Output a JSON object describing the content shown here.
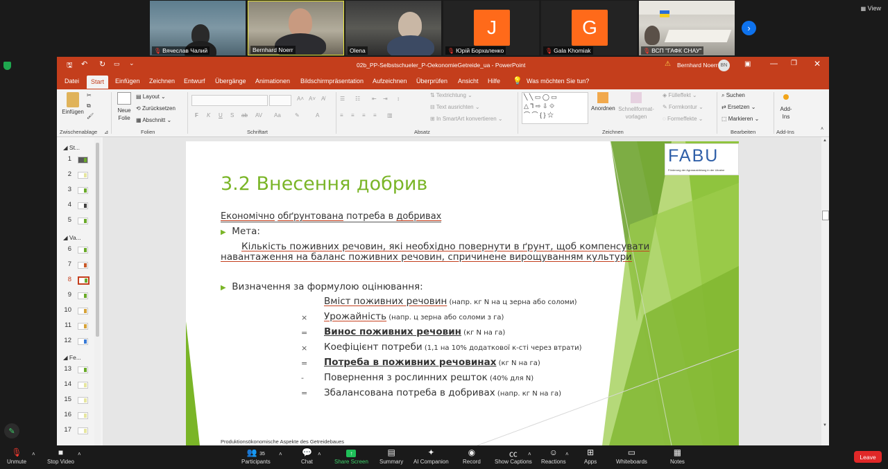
{
  "zoom": {
    "view_label": "View",
    "participants": [
      {
        "name": "Вячеслав Чалий",
        "muted": true
      },
      {
        "name": "Bernhard Noerr",
        "muted": false
      },
      {
        "name": "Olena",
        "muted": false
      },
      {
        "name": "Юрій Борхаленко",
        "muted": true,
        "initial": "J",
        "color": "#ff6a1a"
      },
      {
        "name": "Gala Khomiak",
        "muted": true,
        "initial": "G",
        "color": "#ff6a1a"
      },
      {
        "name": "ВСП \"ГАФК СНАУ\"",
        "muted": true
      }
    ],
    "toolbar": {
      "unmute": "Unmute",
      "stop_video": "Stop Video",
      "participants": "Participants",
      "participants_count": "35",
      "chat": "Chat",
      "share_screen": "Share Screen",
      "summary": "Summary",
      "ai_companion": "AI Companion",
      "record": "Record",
      "show_captions": "Show Captions",
      "reactions": "Reactions",
      "apps": "Apps",
      "whiteboards": "Whiteboards",
      "notes": "Notes",
      "leave": "Leave"
    }
  },
  "powerpoint": {
    "title": "02b_PP-Selbstschueler_P-OekonomieGetreide_ua  -  PowerPoint",
    "warning": "⚠",
    "user_name": "Bernhard Noerr",
    "user_initials": "BN",
    "tabs": [
      "Datei",
      "Start",
      "Einfügen",
      "Zeichnen",
      "Entwurf",
      "Übergänge",
      "Animationen",
      "Bildschirmpräsentation",
      "Aufzeichnen",
      "Überprüfen",
      "Ansicht",
      "Hilfe"
    ],
    "active_tab": "Start",
    "tell_me": "Was möchten Sie tun?",
    "ribbon": {
      "einfuegen": "Einfügen",
      "zwischenablage": "Zwischenablage",
      "neue_folie_1": "Neue",
      "neue_folie_2": "Folie",
      "layout": "Layout",
      "zuruecksetzen": "Zurücksetzen",
      "abschnitt": "Abschnitt",
      "folien": "Folien",
      "schriftart": "Schriftart",
      "font_buttons": [
        "F",
        "K",
        "U",
        "S",
        "ab",
        "AV",
        "Aa",
        "A"
      ],
      "absatz": "Absatz",
      "textrichtung": "Textrichtung",
      "text_ausrichten": "Text ausrichten",
      "smartart": "In SmartArt konvertieren",
      "anordnen": "Anordnen",
      "schnellformat_1": "Schnellformat-",
      "schnellformat_2": "vorlagen",
      "fuelleffekt": "Fülleffekt",
      "formkontur": "Formkontur",
      "formeffekte": "Formeffekte",
      "zeichnen": "Zeichnen",
      "suchen": "Suchen",
      "ersetzen": "Ersetzen",
      "markieren": "Markieren",
      "bearbeiten": "Bearbeiten",
      "addins_1": "Add-",
      "addins_2": "Ins",
      "addins_group": "Add-Ins"
    },
    "sections": [
      "St...",
      "Va...",
      "Fe..."
    ],
    "slide_numbers": [
      "1",
      "2",
      "3",
      "4",
      "5",
      "6",
      "7",
      "8",
      "9",
      "10",
      "11",
      "12",
      "13",
      "14",
      "15",
      "16",
      "17"
    ],
    "selected_slide": "8"
  },
  "slide": {
    "logo_text": "FABU",
    "logo_subtitle": "Förderung der Agrarausbildung in der Ukraine",
    "title": "3.2 Внесення добрив",
    "subtitle_p1": "Економічно",
    "subtitle_p2": " ",
    "subtitle_p3": "обґрунтована",
    "subtitle_p4": " потреба в ",
    "subtitle_p5": "добривах",
    "bullet1": "Мета:",
    "goal_line1": "Кількість поживних речовин, які необхідно повернути в ґрунт, щоб компенсувати",
    "goal_line2": "навантаження на баланс поживних речовин, спричинене вирощуванням культури",
    "bullet2": "Визначення за формулою оцінювання:",
    "formula": [
      {
        "op": "",
        "main": "Вміст поживних речовин",
        "note": " (напр. кг N на ц зерна або соломи)"
      },
      {
        "op": "×",
        "main": "Урожайність",
        "note": " (напр. ц зерна або соломи з га)"
      },
      {
        "op": "=",
        "main": "Винос поживних речовин",
        "note": " (кг N на га)"
      },
      {
        "op": "×",
        "main": "Коефіцієнт потреби",
        "note": " (1,1 на 10% додаткової к-сті через втрати)"
      },
      {
        "op": "=",
        "main": "Потреба в поживних речовинах",
        "note": " (кг N на га)"
      },
      {
        "op": "-",
        "main": "Повернення з рослинних решток",
        "note": " (40% для N)"
      },
      {
        "op": "=",
        "main": "Збалансована потреба в добривах",
        "note": " (напр. кг N на га)"
      }
    ],
    "footer": "Produktionsökonomische Aspekte des Getreidebaues"
  },
  "colors": {
    "powerpoint_red": "#c43e1c",
    "slide_green": "#7ab527",
    "zoom_blue": "#0e72ed",
    "leave_red": "#e02828"
  }
}
